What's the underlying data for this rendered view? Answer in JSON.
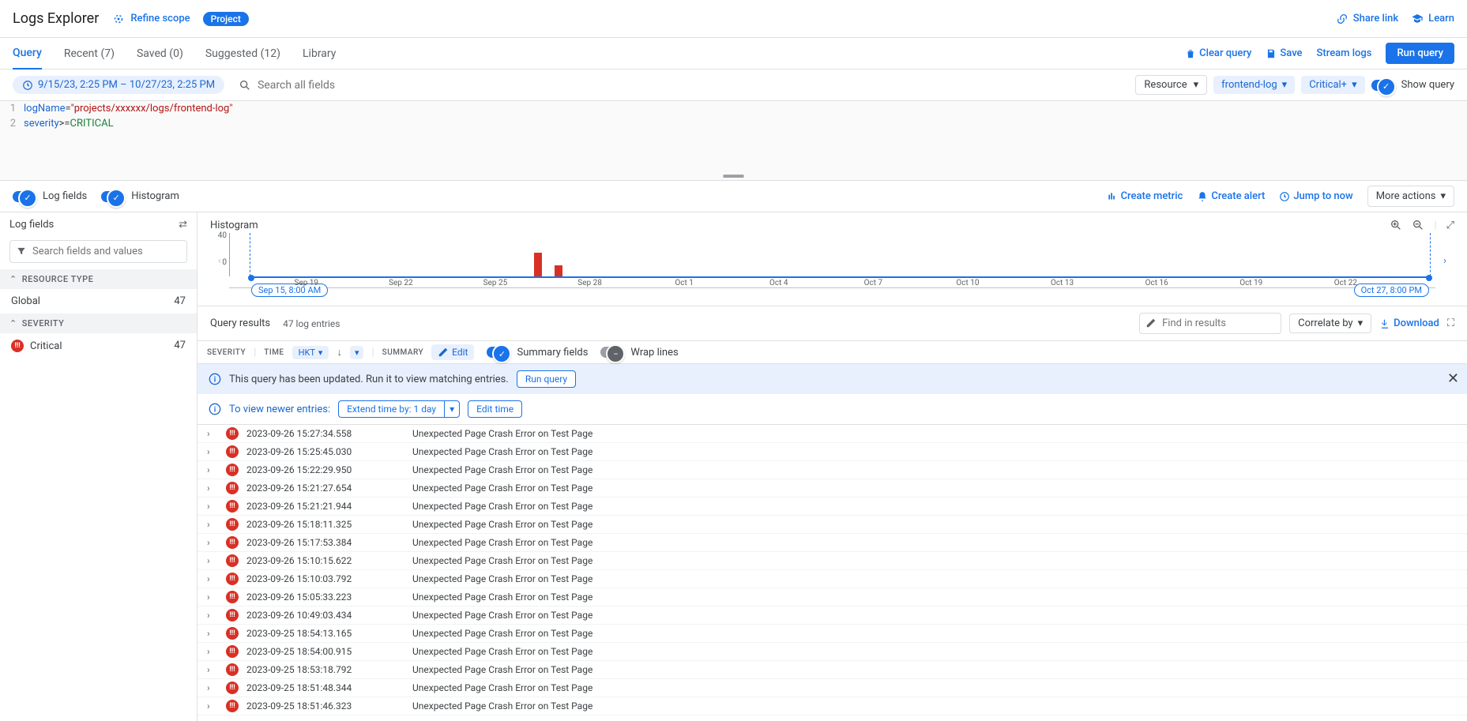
{
  "header": {
    "title": "Logs Explorer",
    "refine": "Refine scope",
    "scope_badge": "Project",
    "share": "Share link",
    "learn": "Learn"
  },
  "tabs": {
    "query": "Query",
    "recent": "Recent (7)",
    "saved": "Saved (0)",
    "suggested": "Suggested (12)",
    "library": "Library"
  },
  "tab_actions": {
    "clear": "Clear query",
    "save": "Save",
    "stream": "Stream logs",
    "run": "Run query"
  },
  "filter_row": {
    "range": "9/15/23, 2:25 PM – 10/27/23, 2:25 PM",
    "search_placeholder": "Search all fields",
    "resource": "Resource",
    "logname": "frontend-log",
    "severity": "Critical+",
    "show_query": "Show query"
  },
  "editor": {
    "l1_key": "logName",
    "l1_eq": "=",
    "l1_val": "\"projects/xxxxxx/logs/frontend-log\"",
    "l2_key": "severity",
    "l2_op": ">=",
    "l2_val": "CRITICAL"
  },
  "toolbar2": {
    "log_fields": "Log fields",
    "histogram": "Histogram",
    "create_metric": "Create metric",
    "create_alert": "Create alert",
    "jump_now": "Jump to now",
    "more": "More actions"
  },
  "left_panel": {
    "title": "Log fields",
    "search_placeholder": "Search fields and values",
    "sec_resource": "RESOURCE TYPE",
    "global": "Global",
    "global_count": "47",
    "sec_severity": "SEVERITY",
    "critical": "Critical",
    "critical_count": "47"
  },
  "histo": {
    "title": "Histogram",
    "y_max": "40",
    "y_min": "0",
    "start_chip": "Sep 15, 8:00 AM",
    "end_chip": "Oct 27, 8:00 PM",
    "ticks": [
      "Sep 19",
      "Sep 22",
      "Sep 25",
      "Sep 28",
      "Oct 1",
      "Oct 4",
      "Oct 7",
      "Oct 10",
      "Oct 13",
      "Oct 16",
      "Oct 19",
      "Oct 22"
    ]
  },
  "qr": {
    "title": "Query results",
    "count": "47 log entries",
    "find_placeholder": "Find in results",
    "correlate": "Correlate by",
    "download": "Download"
  },
  "cols": {
    "severity": "SEVERITY",
    "time": "TIME",
    "tz": "HKT",
    "summary": "SUMMARY",
    "edit": "Edit",
    "summary_fields": "Summary fields",
    "wrap": "Wrap lines"
  },
  "banner1": {
    "text": "This query has been updated. Run it to view matching entries.",
    "btn": "Run query"
  },
  "banner2": {
    "text": "To view newer entries:",
    "extend": "Extend time by: 1 day",
    "edit_time": "Edit time"
  },
  "logs": [
    {
      "ts": "2023-09-26 15:27:34.558",
      "msg": "Unexpected Page Crash Error on Test Page"
    },
    {
      "ts": "2023-09-26 15:25:45.030",
      "msg": "Unexpected Page Crash Error on Test Page"
    },
    {
      "ts": "2023-09-26 15:22:29.950",
      "msg": "Unexpected Page Crash Error on Test Page"
    },
    {
      "ts": "2023-09-26 15:21:27.654",
      "msg": "Unexpected Page Crash Error on Test Page"
    },
    {
      "ts": "2023-09-26 15:21:21.944",
      "msg": "Unexpected Page Crash Error on Test Page"
    },
    {
      "ts": "2023-09-26 15:18:11.325",
      "msg": "Unexpected Page Crash Error on Test Page"
    },
    {
      "ts": "2023-09-26 15:17:53.384",
      "msg": "Unexpected Page Crash Error on Test Page"
    },
    {
      "ts": "2023-09-26 15:10:15.622",
      "msg": "Unexpected Page Crash Error on Test Page"
    },
    {
      "ts": "2023-09-26 15:10:03.792",
      "msg": "Unexpected Page Crash Error on Test Page"
    },
    {
      "ts": "2023-09-26 15:05:33.223",
      "msg": "Unexpected Page Crash Error on Test Page"
    },
    {
      "ts": "2023-09-26 10:49:03.434",
      "msg": "Unexpected Page Crash Error on Test Page"
    },
    {
      "ts": "2023-09-25 18:54:13.165",
      "msg": "Unexpected Page Crash Error on Test Page"
    },
    {
      "ts": "2023-09-25 18:54:00.915",
      "msg": "Unexpected Page Crash Error on Test Page"
    },
    {
      "ts": "2023-09-25 18:53:18.792",
      "msg": "Unexpected Page Crash Error on Test Page"
    },
    {
      "ts": "2023-09-25 18:51:48.344",
      "msg": "Unexpected Page Crash Error on Test Page"
    },
    {
      "ts": "2023-09-25 18:51:46.323",
      "msg": "Unexpected Page Crash Error on Test Page"
    }
  ]
}
